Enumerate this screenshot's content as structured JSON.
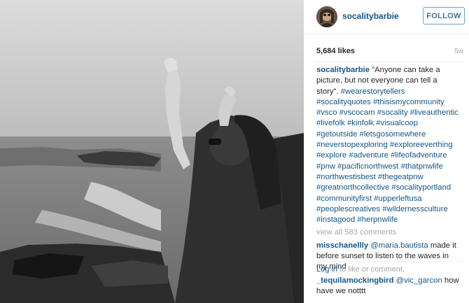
{
  "post": {
    "username": "socalitybarbie",
    "follow_label": "FOLLOW",
    "likes": "5,684 likes",
    "age": "5w",
    "caption": {
      "username": "socalitybarbie",
      "line1": "\"Anyone can take a",
      "line2": "picture, but not everyone can tell a",
      "line3_text": "story\".",
      "hashtag_lines": [
        "#wearestorytellers",
        "#socalityquotes #thisismycommunity",
        "#vsco #vscocam #socality #liveauthentic",
        "#livefolk #kinfolk #visualcoop",
        "#getoutside #letsgosomewhere",
        "#neverstopexploring #exploreeverthing",
        "#explore #adventure #lifeofadventure",
        "#pnw #pacificnorthwest #thatpnwlife",
        "#northwestisbest #thegeatpnw",
        "#greatnorthcollective #socalityportland",
        "#communityfirst #upperleftusa",
        "#peoplescreatives #wildernessculture",
        "#instagood #herpnwlife"
      ]
    },
    "view_all": "view all 583 comments",
    "comments": [
      {
        "username": "misschanellly",
        "mention": "@maria.bautista",
        "text_line1": "made it",
        "text_line2": "before sunset to listen to the waves in",
        "text_line3": "my mind"
      },
      {
        "username": "_tequilamockingbird",
        "mention": "@vic_garcon",
        "text_line1": "how",
        "text_line2": "have we notttt"
      }
    ],
    "login": {
      "link": "Log in",
      "rest": "to like or comment."
    }
  }
}
